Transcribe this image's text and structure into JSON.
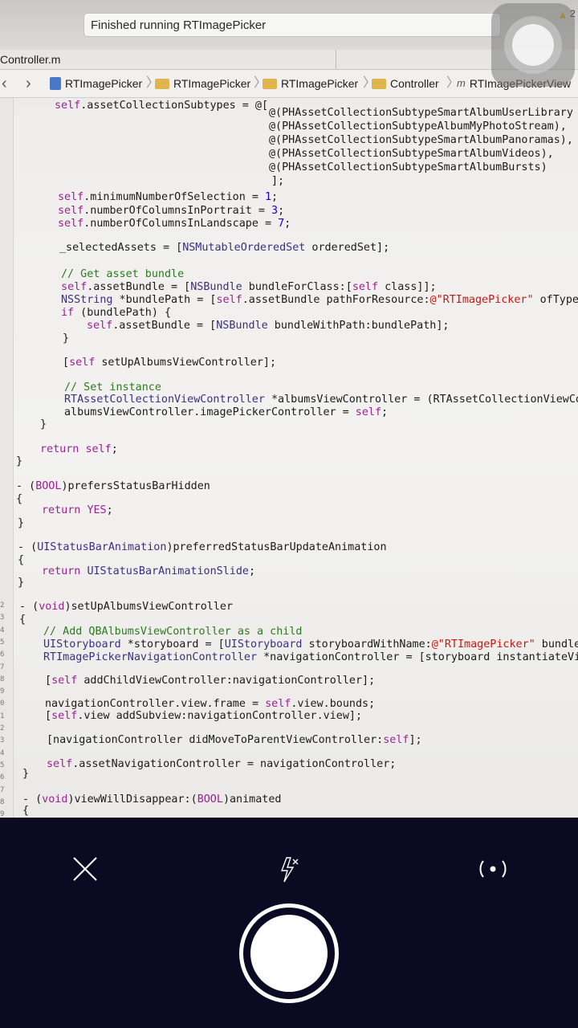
{
  "viewfinder": {
    "status_message": "Finished running RTImagePicker",
    "warning_count": "2",
    "file_tab": "Controller.m",
    "jumpbar": [
      "RTImagePicker",
      "RTImagePicker",
      "RTImagePicker",
      "Controller",
      "RTImagePickerView"
    ],
    "gutter_numbers": [
      "2",
      "3",
      "4",
      "5",
      "6",
      "7",
      "8",
      "9",
      "0",
      "1",
      "2",
      "3",
      "4",
      "5",
      "6",
      "7",
      "8",
      "9"
    ],
    "code_lines": [
      "self.assetCollectionSubtypes = @[",
      "@(PHAssetCollectionSubtypeSmartAlbumUserLibrary",
      "@(PHAssetCollectionSubtypeAlbumMyPhotoStream),",
      "@(PHAssetCollectionSubtypeSmartAlbumPanoramas),",
      "@(PHAssetCollectionSubtypeSmartAlbumVideos),",
      "@(PHAssetCollectionSubtypeSmartAlbumBursts)",
      "];",
      "self.minimumNumberOfSelection = 1;",
      "self.numberOfColumnsInPortrait = 3;",
      "self.numberOfColumnsInLandscape = 7;",
      "_selectedAssets = [NSMutableOrderedSet orderedSet];",
      "// Get asset bundle",
      "self.assetBundle = [NSBundle bundleForClass:[self class]];",
      "NSString *bundlePath = [self.assetBundle pathForResource:@\"RTImagePicker\" ofType:",
      "if (bundlePath) {",
      "self.assetBundle = [NSBundle bundleWithPath:bundlePath];",
      "}",
      "[self setUpAlbumsViewController];",
      "// Set instance",
      "RTAssetCollectionViewController *albumsViewController = (RTAssetCollectionViewCon",
      "albumsViewController.imagePickerController = self;",
      "}",
      "return self;",
      "}",
      "- (BOOL)prefersStatusBarHidden",
      "{",
      "return YES;",
      "}",
      "- (UIStatusBarAnimation)preferredStatusBarUpdateAnimation",
      "{",
      "return UIStatusBarAnimationSlide;",
      "}",
      "- (void)setUpAlbumsViewController",
      "{",
      "// Add QBAlbumsViewController as a child",
      "UIStoryboard *storyboard = [UIStoryboard storyboardWithName:@\"RTImagePicker\" bundle:s",
      "RTImagePickerNavigationController *navigationController = [storyboard instantiateView",
      "[self addChildViewController:navigationController];",
      "navigationController.view.frame = self.view.bounds;",
      "[self.view addSubview:navigationController.view];",
      "[navigationController didMoveToParentViewController:self];",
      "self.assetNavigationController = navigationController;",
      "}",
      "- (void)viewWillDisappear:(BOOL)animated",
      "{"
    ]
  },
  "camera_controls": {
    "close_icon": "close-icon",
    "flash_icon": "flash-off-icon",
    "flip_icon": "camera-flip-icon",
    "shutter": "shutter-button"
  },
  "colors": {
    "bar_background": "#0b0a22",
    "shutter": "#ffffff",
    "keyword": "#9b2393",
    "string": "#c41a16",
    "comment": "#2c7a20"
  }
}
